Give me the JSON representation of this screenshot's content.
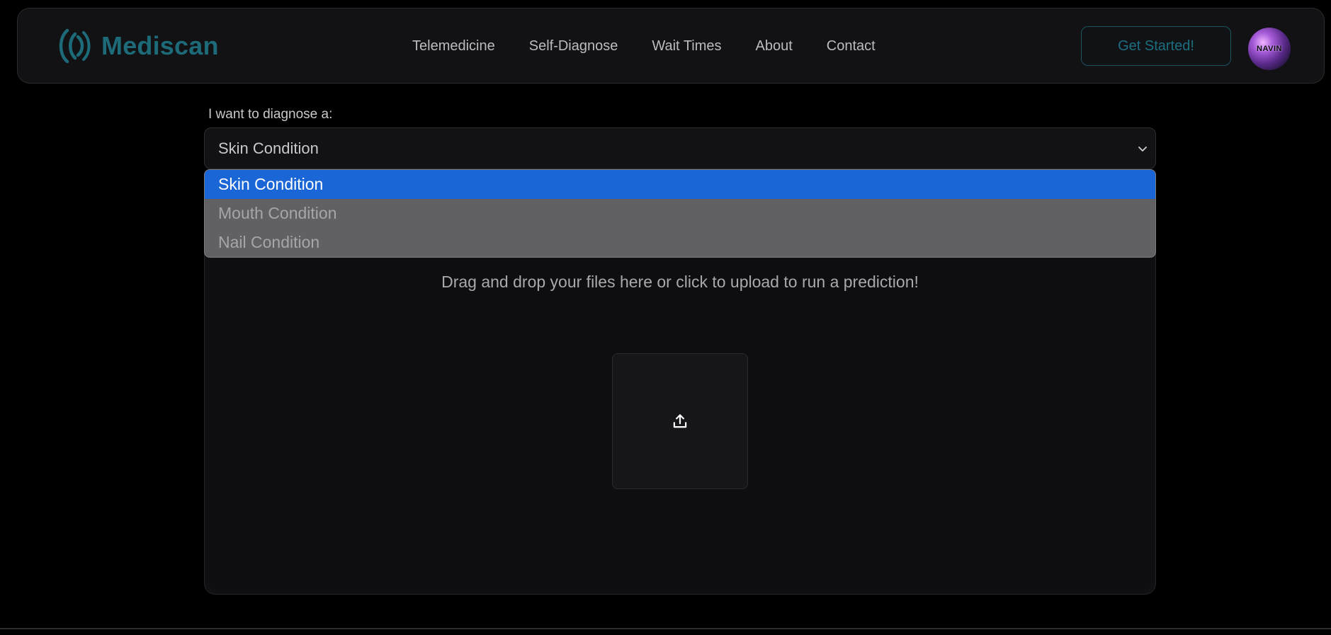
{
  "navbar": {
    "brand": "Mediscan",
    "links": [
      "Telemedicine",
      "Self-Diagnose",
      "Wait Times",
      "About",
      "Contact"
    ],
    "cta_label": "Get Started!",
    "avatar_text": "NAVIN"
  },
  "diagnose": {
    "label": "I want to diagnose a:",
    "selected": "Skin Condition",
    "options": [
      "Skin Condition",
      "Mouth Condition",
      "Nail Condition"
    ]
  },
  "upload": {
    "prompt": "Drag and drop your files here or click to upload to run a prediction!"
  },
  "icons": {
    "brand": "sound-wave-logo-icon",
    "select": "chevron-down-icon",
    "upload": "upload-icon"
  },
  "colors": {
    "background": "#000000",
    "brand_teal": "#1d6a79",
    "option_highlight": "#1a66d6"
  }
}
